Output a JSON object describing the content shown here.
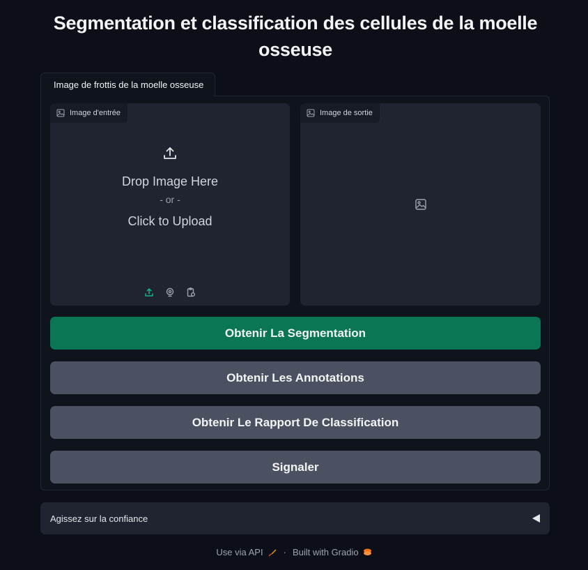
{
  "page": {
    "title": "Segmentation et classification des cellules de la moelle osseuse"
  },
  "tab": {
    "label": "Image de frottis de la moelle osseuse"
  },
  "input_image": {
    "label": "Image d'entrée",
    "drop_text": "Drop Image Here",
    "or_text": "- or -",
    "click_text": "Click to Upload",
    "sources": [
      "upload-icon",
      "webcam-icon",
      "clipboard-icon"
    ]
  },
  "output_image": {
    "label": "Image de sortie"
  },
  "buttons": {
    "segmentation": "Obtenir La Segmentation",
    "annotations": "Obtenir Les Annotations",
    "report": "Obtenir Le Rapport De Classification",
    "flag": "Signaler"
  },
  "accordion": {
    "label": "Agissez sur la confiance"
  },
  "footer": {
    "api_text": "Use via API",
    "separator": "·",
    "built_text": "Built with Gradio"
  },
  "colors": {
    "background": "#0c0f17",
    "primary_button": "#0b7655",
    "secondary_button": "#4b5160",
    "accent_icon": "#10b981"
  }
}
